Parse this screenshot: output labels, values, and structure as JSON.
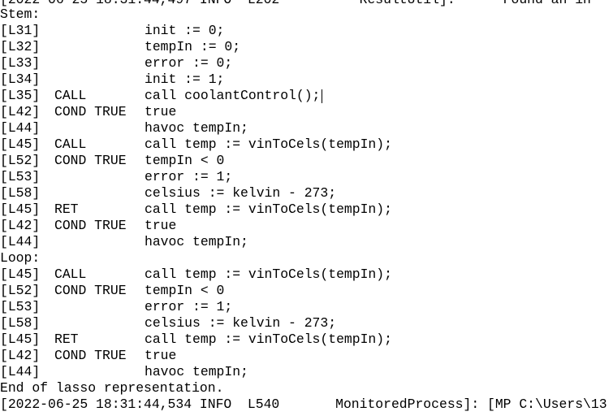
{
  "console": {
    "header_cut": "[2022-06-25 18:31:44,497 INFO  L202          ResultUtil]:      Found an in",
    "rows": [
      {
        "text": "Stem:"
      },
      {
        "line": "[L31]",
        "kind": "",
        "stmt": "init := 0;"
      },
      {
        "line": "[L32]",
        "kind": "",
        "stmt": "tempIn := 0;"
      },
      {
        "line": "[L33]",
        "kind": "",
        "stmt": "error := 0;"
      },
      {
        "line": "[L34]",
        "kind": "",
        "stmt": "init := 1;"
      },
      {
        "line": "[L35]",
        "kind": "CALL",
        "stmt": "call coolantControl();"
      },
      {
        "line": "[L42]",
        "kind": "COND TRUE",
        "stmt": "true"
      },
      {
        "line": "[L44]",
        "kind": "",
        "stmt": "havoc tempIn;"
      },
      {
        "line": "[L45]",
        "kind": "CALL",
        "stmt": "call temp := vinToCels(tempIn);"
      },
      {
        "line": "[L52]",
        "kind": "COND TRUE",
        "stmt": "tempIn < 0"
      },
      {
        "line": "[L53]",
        "kind": "",
        "stmt": "error := 1;"
      },
      {
        "line": "[L58]",
        "kind": "",
        "stmt": "celsius := kelvin - 273;"
      },
      {
        "line": "[L45]",
        "kind": "RET",
        "stmt": "call temp := vinToCels(tempIn);"
      },
      {
        "line": "[L42]",
        "kind": "COND TRUE",
        "stmt": "true"
      },
      {
        "line": "[L44]",
        "kind": "",
        "stmt": "havoc tempIn;"
      },
      {
        "text": "Loop:"
      },
      {
        "line": "[L45]",
        "kind": "CALL",
        "stmt": "call temp := vinToCels(tempIn);"
      },
      {
        "line": "[L52]",
        "kind": "COND TRUE",
        "stmt": "tempIn < 0"
      },
      {
        "line": "[L53]",
        "kind": "",
        "stmt": "error := 1;"
      },
      {
        "line": "[L58]",
        "kind": "",
        "stmt": "celsius := kelvin - 273;"
      },
      {
        "line": "[L45]",
        "kind": "RET",
        "stmt": "call temp := vinToCels(tempIn);"
      },
      {
        "line": "[L42]",
        "kind": "COND TRUE",
        "stmt": "true"
      },
      {
        "line": "[L44]",
        "kind": "",
        "stmt": "havoc tempIn;"
      },
      {
        "text": "End of lasso representation."
      },
      {
        "text": "[2022-06-25 18:31:44,534 INFO  L540       MonitoredProcess]: [MP C:\\Users\\13"
      }
    ]
  }
}
